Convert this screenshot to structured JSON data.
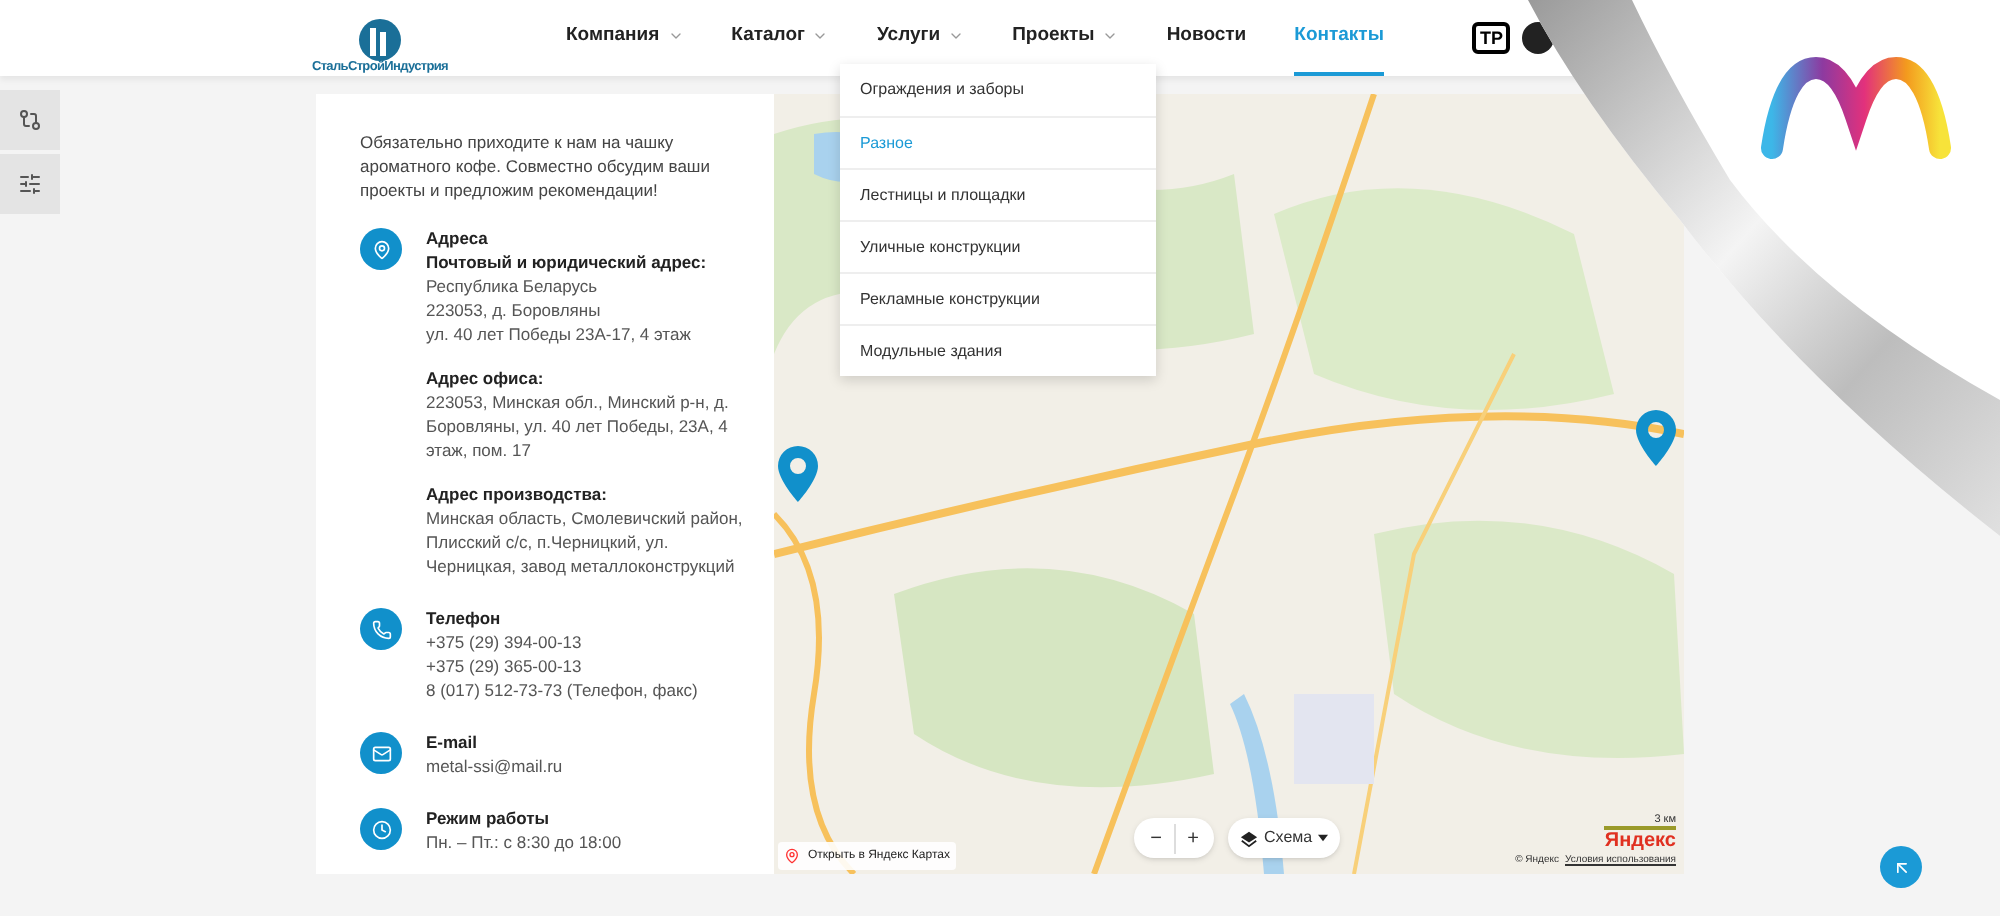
{
  "header": {
    "logo_text": "СтальСтройИндустрия",
    "nav": [
      {
        "label": "Компания",
        "has_menu": true,
        "selected": false
      },
      {
        "label": "Каталог",
        "has_menu": true,
        "selected": false
      },
      {
        "label": "Услуги",
        "has_menu": true,
        "selected": false
      },
      {
        "label": "Проекты",
        "has_menu": true,
        "selected": false
      },
      {
        "label": "Новости",
        "has_menu": false,
        "selected": false
      },
      {
        "label": "Контакты",
        "has_menu": false,
        "selected": true
      }
    ],
    "badge": "TP"
  },
  "dropdown": {
    "items": [
      {
        "label": "Ограждения и заборы",
        "selected": false
      },
      {
        "label": "Разное",
        "selected": true
      },
      {
        "label": "Лестницы и площадки",
        "selected": false
      },
      {
        "label": "Уличные конструкции",
        "selected": false
      },
      {
        "label": "Рекламные конструкции",
        "selected": false
      },
      {
        "label": "Модульные здания",
        "selected": false
      }
    ]
  },
  "contacts": {
    "intro": "Обязательно приходите к нам на чашку ароматного кофе. Совместно обсудим ваши проекты и предложим рекомендации!",
    "sections": [
      {
        "kind": "address",
        "title": "Адреса",
        "groups": [
          {
            "heading": "Почтовый и юридический адрес:",
            "lines": [
              "Республика Беларусь",
              "223053, д. Боровляны",
              "ул. 40 лет Победы 23А-17, 4 этаж"
            ]
          },
          {
            "heading": "Адрес офиса:",
            "lines": [
              "223053, Минская обл., Минский р-н, д. Боровляны, ул. 40 лет Победы, 23А, 4 этаж, пом. 17"
            ]
          },
          {
            "heading": "Адрес производства:",
            "lines": [
              "Минская область, Смолевичский район, Плисский с/с, п.Черницкий, ул. Черницкая, завод металлоконструкций"
            ]
          }
        ]
      },
      {
        "kind": "phone",
        "title": "Телефон",
        "lines": [
          "+375 (29) 394-00-13",
          "+375 (29) 365-00-13",
          "8 (017) 512-73-73 (Телефон, факс)"
        ]
      },
      {
        "kind": "email",
        "title": "E-mail",
        "lines": [
          "metal-ssi@mail.ru"
        ]
      },
      {
        "kind": "hours",
        "title": "Режим работы",
        "lines": [
          "Пн. – Пт.: с 8:30 до 18:00"
        ]
      }
    ]
  },
  "map": {
    "open_link": "Открыть в Яндекс Картах",
    "zoom_out": "−",
    "zoom_in": "+",
    "layers": "Схема",
    "scale": "3 км",
    "brand": "Яндекс",
    "copyright": "© Яндекс",
    "terms": "Условия использования"
  }
}
